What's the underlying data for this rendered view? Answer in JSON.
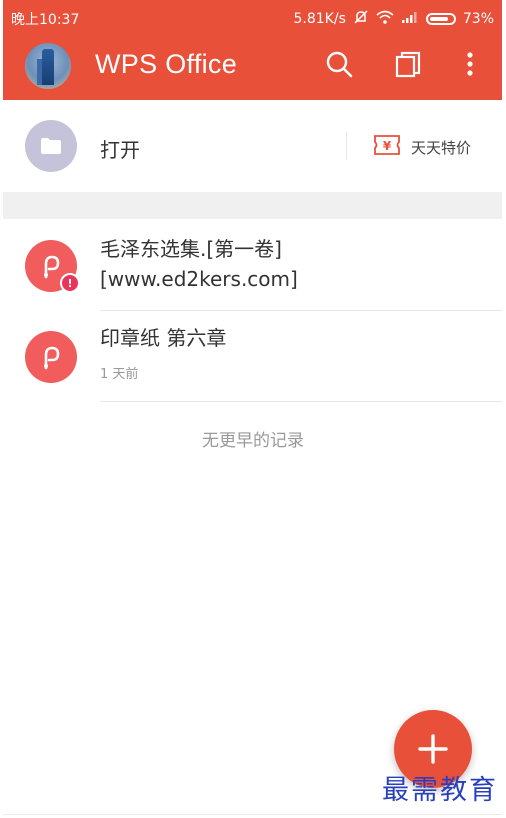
{
  "status_bar": {
    "time": "晚上10:37",
    "network_speed": "5.81K/s",
    "battery": "73%",
    "icons": [
      "mute-icon",
      "wifi-icon",
      "signal-icon",
      "battery-icon"
    ]
  },
  "header": {
    "title": "WPS Office",
    "background_color": "#e8503a",
    "actions": [
      "search-icon",
      "windows-icon",
      "more-icon"
    ]
  },
  "quick_open": {
    "label": "打开",
    "promo_label": "天天特价"
  },
  "recent_files": [
    {
      "title_line1": "毛泽东选集.[第一卷]",
      "title_line2": "[www.ed2kers.com]",
      "status": "error",
      "time": ""
    },
    {
      "title_line1": "印章纸 第六章",
      "title_line2": "",
      "status": "normal",
      "time": "1 天前"
    }
  ],
  "footer_note": "无更早的记录",
  "fab": {
    "icon": "plus-icon"
  },
  "watermark": "最需教育"
}
